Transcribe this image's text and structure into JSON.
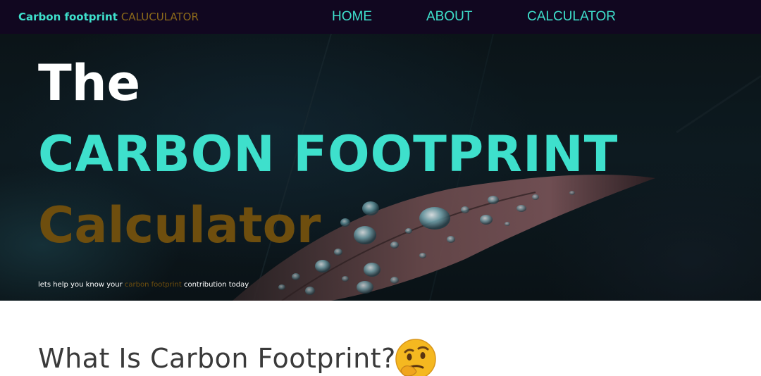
{
  "navbar": {
    "brand_strong": "Carbon footprint",
    "brand_light": "CALUCULATOR",
    "links": [
      {
        "label": "HOME"
      },
      {
        "label": "ABOUT"
      },
      {
        "label": "CALCULATOR"
      }
    ]
  },
  "hero": {
    "title_the": "The",
    "title_main": "CARBON FOOTPRINT",
    "title_calc": "Calculator",
    "subtitle_before": "lets help you know your",
    "subtitle_accent": "carbon footprint",
    "subtitle_after": "contribution today"
  },
  "section": {
    "title": "What Is Carbon Footprint?",
    "emoji_icon": "thinking-face-icon"
  },
  "colors": {
    "nav_bg": "#110720",
    "accent_teal": "#3ee0cc",
    "accent_brown": "#6e4e0e",
    "heading_text": "#3a3a3a"
  }
}
